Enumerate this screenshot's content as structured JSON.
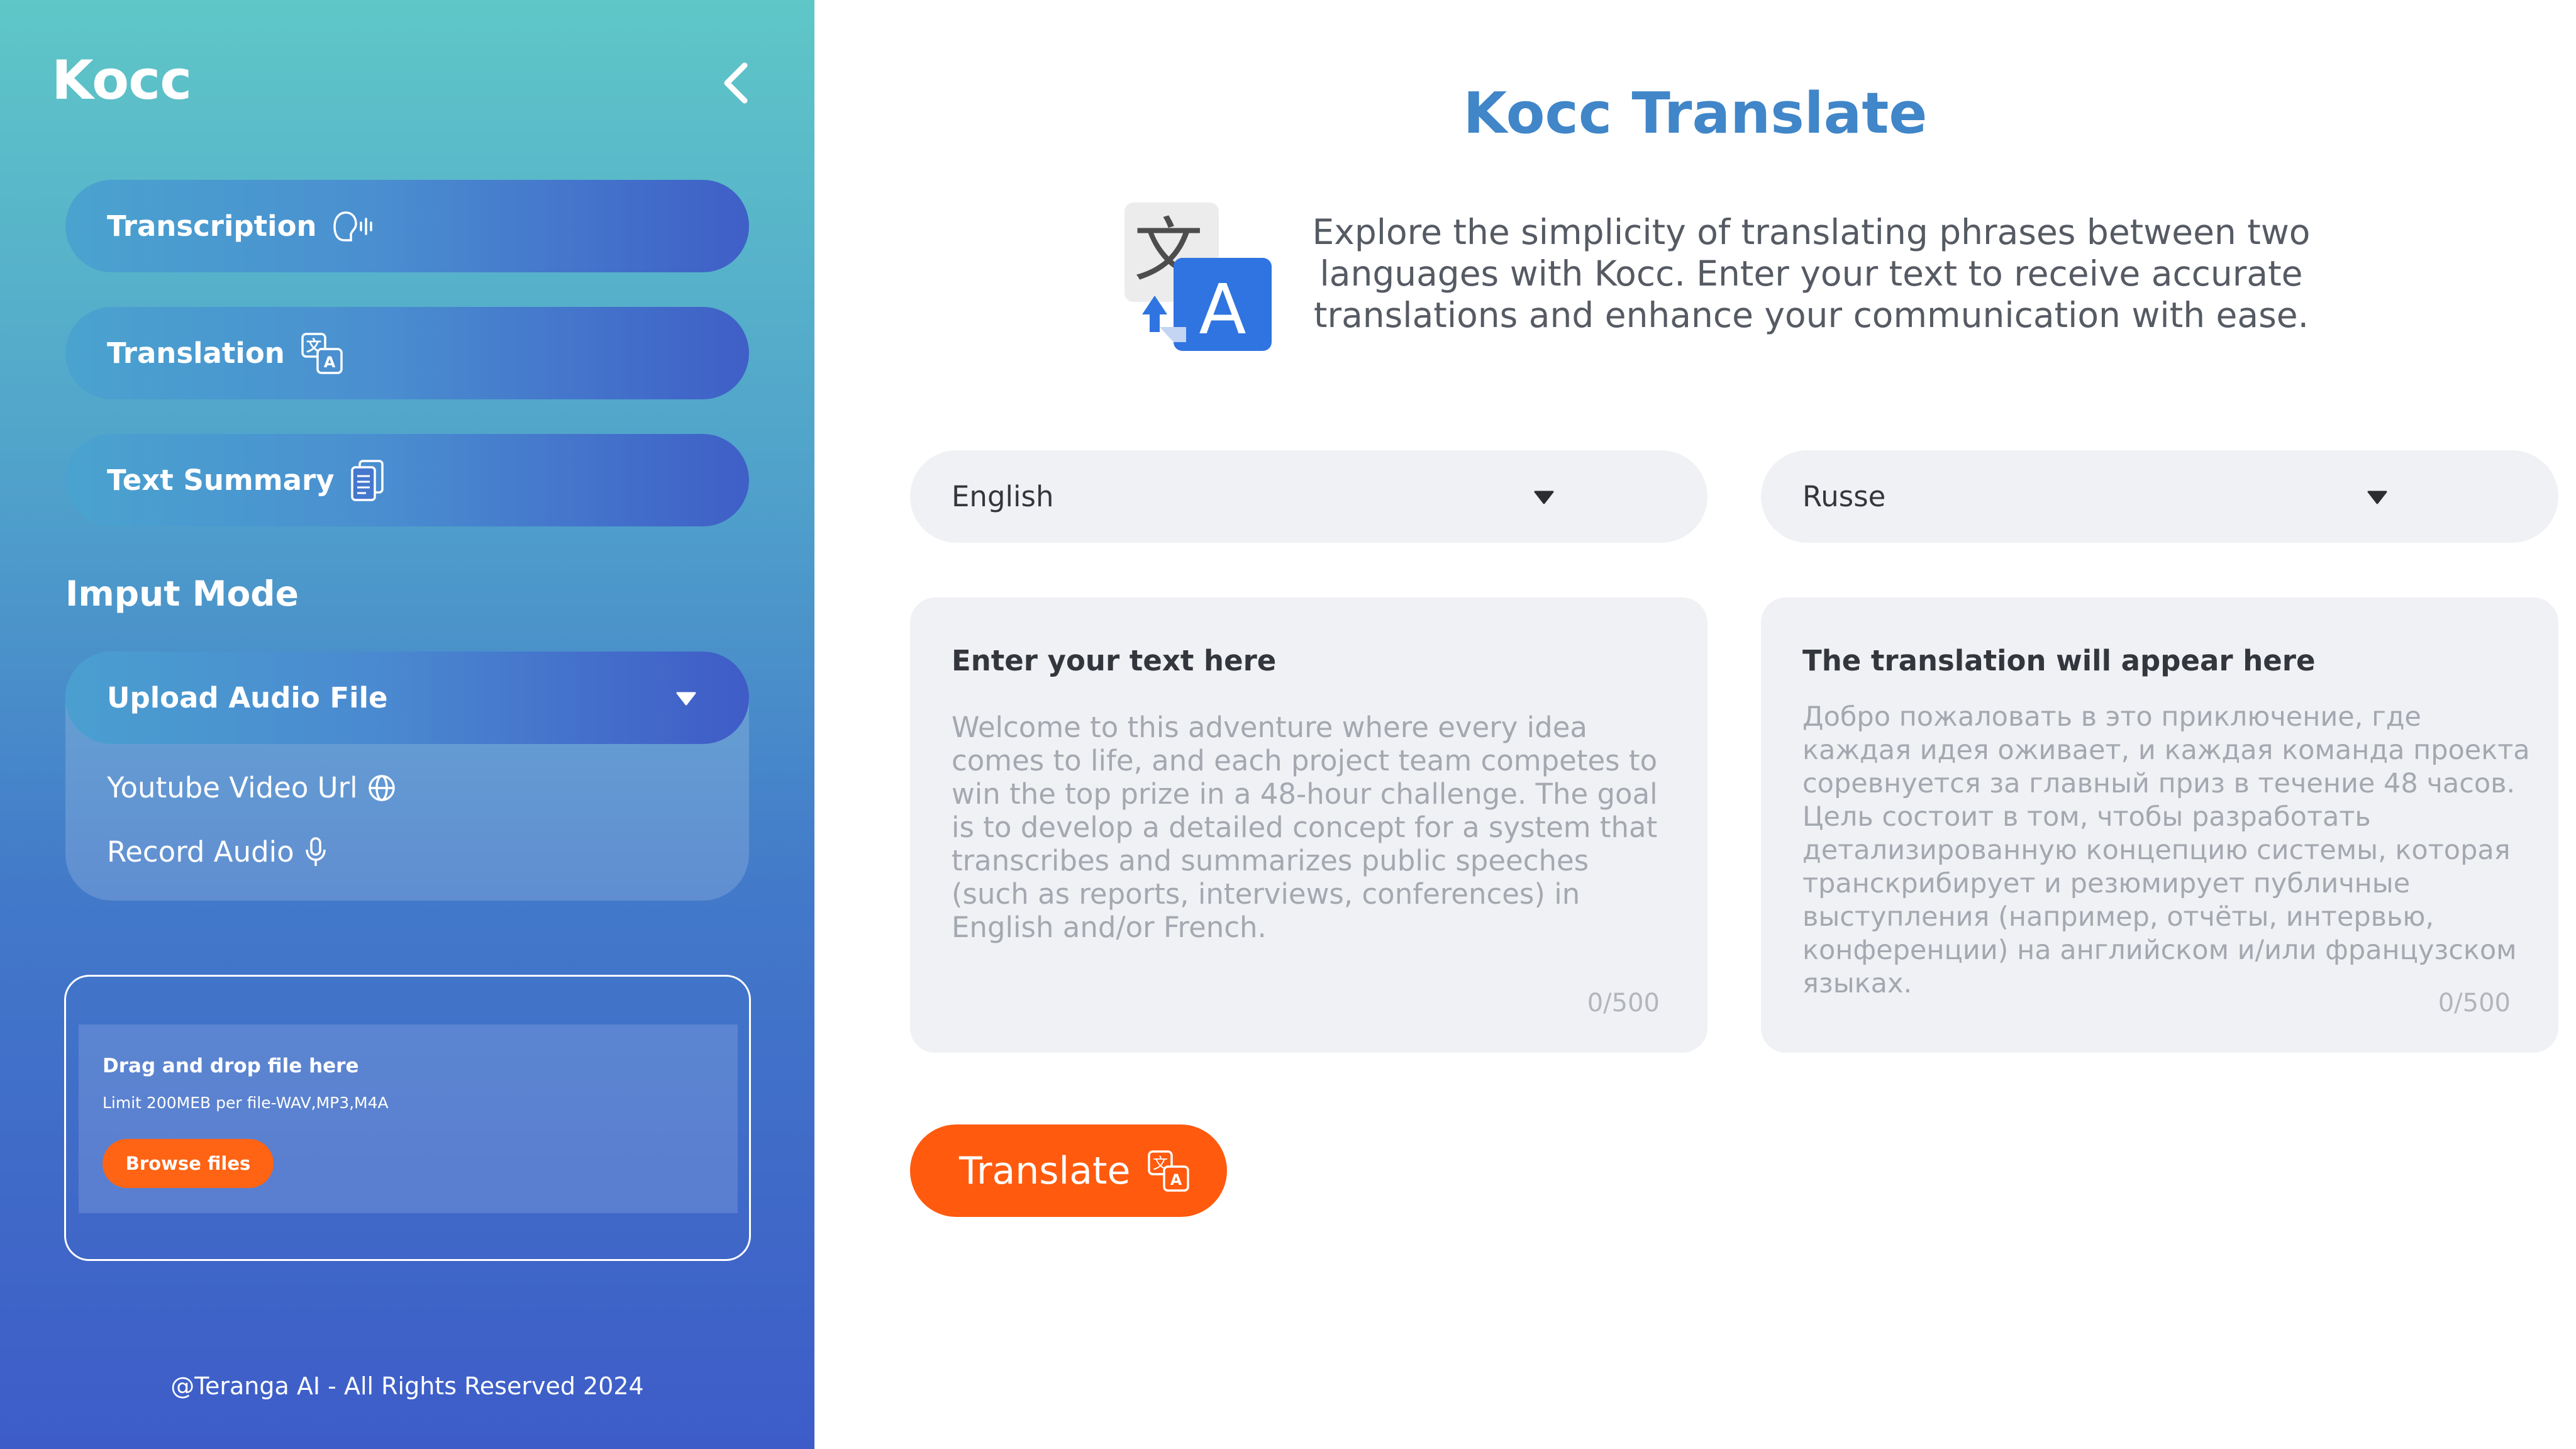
{
  "sidebar": {
    "brand": "Kocc",
    "collapse_icon": "chevron-left-icon",
    "nav": [
      {
        "label": "Transcription",
        "icon": "voice-wave-icon"
      },
      {
        "label": "Translation",
        "icon": "translate-icon"
      },
      {
        "label": "Text Summary",
        "icon": "documents-icon"
      }
    ],
    "input_mode_title": "Imput Mode",
    "input_mode": {
      "selected": "Upload Audio File",
      "options": [
        {
          "label": "Youtube Video Url",
          "icon": "globe-icon"
        },
        {
          "label": "Record Audio",
          "icon": "microphone-icon"
        }
      ]
    },
    "upload": {
      "title": "Drag and drop file here",
      "limit": "Limit 200MEB per file-WAV,MP3,M4A",
      "browse_label": "Browse files"
    },
    "footer": "@Teranga AI - All Rights Reserved 2024"
  },
  "main": {
    "title": "Kocc Translate",
    "intro": "Explore the simplicity of translating phrases between two languages with Kocc. Enter your text to receive accurate translations and enhance your communication with ease.",
    "source_language": "English",
    "target_language": "Russe",
    "source_label": "Enter your text here",
    "source_text": "Welcome to this adventure where every idea comes to life, and each project team competes to win the top prize in a 48-hour challenge. The goal is to develop a detailed concept for a system that transcribes and summarizes public speeches (such as reports, interviews, conferences) in English and/or French.",
    "source_counter": "0/500",
    "target_label": "The translation will appear here",
    "target_text": "Добро пожаловать в это приключение, где каждая идея оживает, и каждая команда проекта соревнуется за главный приз в течение 48 часов. Цель состоит в том, чтобы разработать детализированную концепцию системы, которая транскрибирует и резюмирует публичные выступления (например, отчёты, интервью, конференции) на английском и/или французском языках.",
    "target_counter": "0/500",
    "translate_button": "Translate"
  },
  "colors": {
    "accent_orange": "#ff5a0e",
    "title_blue": "#4086c8",
    "sidebar_top": "#5fc7c8",
    "sidebar_bottom": "#3d5cc8"
  }
}
